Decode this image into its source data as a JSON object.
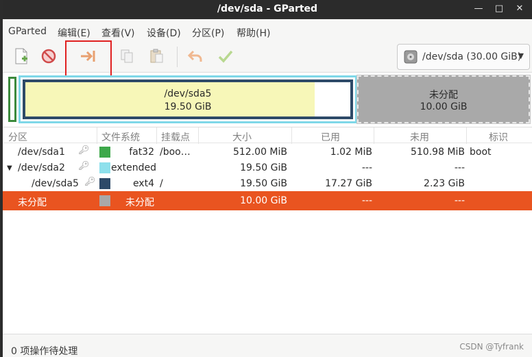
{
  "window": {
    "title": "/dev/sda - GParted"
  },
  "menu": [
    "GParted",
    "编辑(E)",
    "查看(V)",
    "设备(D)",
    "分区(P)",
    "帮助(H)"
  ],
  "toolbar": {
    "icons": [
      "new-partition-icon",
      "delete-icon",
      "resize-move-icon",
      "copy-icon",
      "paste-icon",
      "undo-icon",
      "apply-icon"
    ]
  },
  "device_selector": {
    "label": "/dev/sda  (30.00 GiB)"
  },
  "disk_map": {
    "sda5_name": "/dev/sda5",
    "sda5_size": "19.50 GiB",
    "unalloc_name": "未分配",
    "unalloc_size": "10.00 GiB"
  },
  "table": {
    "headers": [
      "分区",
      "文件系统",
      "挂载点",
      "大小",
      "已用",
      "未用",
      "标识"
    ],
    "rows": [
      {
        "partition": "/dev/sda1",
        "fs": "fat32",
        "mount": "/boo…",
        "size": "512.00 MiB",
        "used": "1.02 MiB",
        "unused": "510.98 MiB",
        "flags": "boot",
        "color": "#3da84a"
      },
      {
        "partition": "/dev/sda2",
        "fs": "extended",
        "mount": "",
        "size": "19.50 GiB",
        "used": "---",
        "unused": "---",
        "flags": "",
        "color": "#8ee0ec"
      },
      {
        "partition": "/dev/sda5",
        "fs": "ext4",
        "mount": "/",
        "size": "19.50 GiB",
        "used": "17.27 GiB",
        "unused": "2.23 GiB",
        "flags": "",
        "color": "#2e4a68"
      },
      {
        "partition": "未分配",
        "fs": "未分配",
        "mount": "",
        "size": "10.00 GiB",
        "used": "---",
        "unused": "---",
        "flags": "",
        "color": "#a9a9a9"
      }
    ]
  },
  "status": {
    "pending": "0 项操作待处理"
  },
  "watermark": "CSDN @Tyfrank"
}
